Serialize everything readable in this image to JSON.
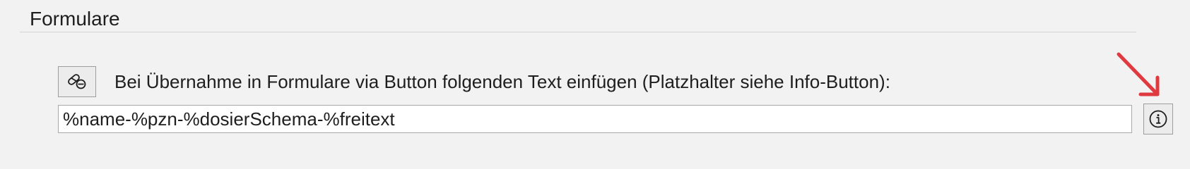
{
  "section": {
    "title": "Formulare"
  },
  "template": {
    "button_icon": "pill-icon",
    "label": "Bei Übernahme in Formulare via Button folgenden Text einfügen (Platzhalter siehe Info-Button):",
    "field_value": "%name-%pzn-%dosierSchema-%freitext",
    "info_icon": "info-circle-icon"
  },
  "annotation": {
    "arrow_icon": "arrow-down-right-icon",
    "arrow_color": "#e0393f"
  },
  "colors": {
    "background": "#f2f2f2",
    "field_background": "#ffffff",
    "border": "#a8a8a8",
    "text": "#1e1e1e"
  }
}
